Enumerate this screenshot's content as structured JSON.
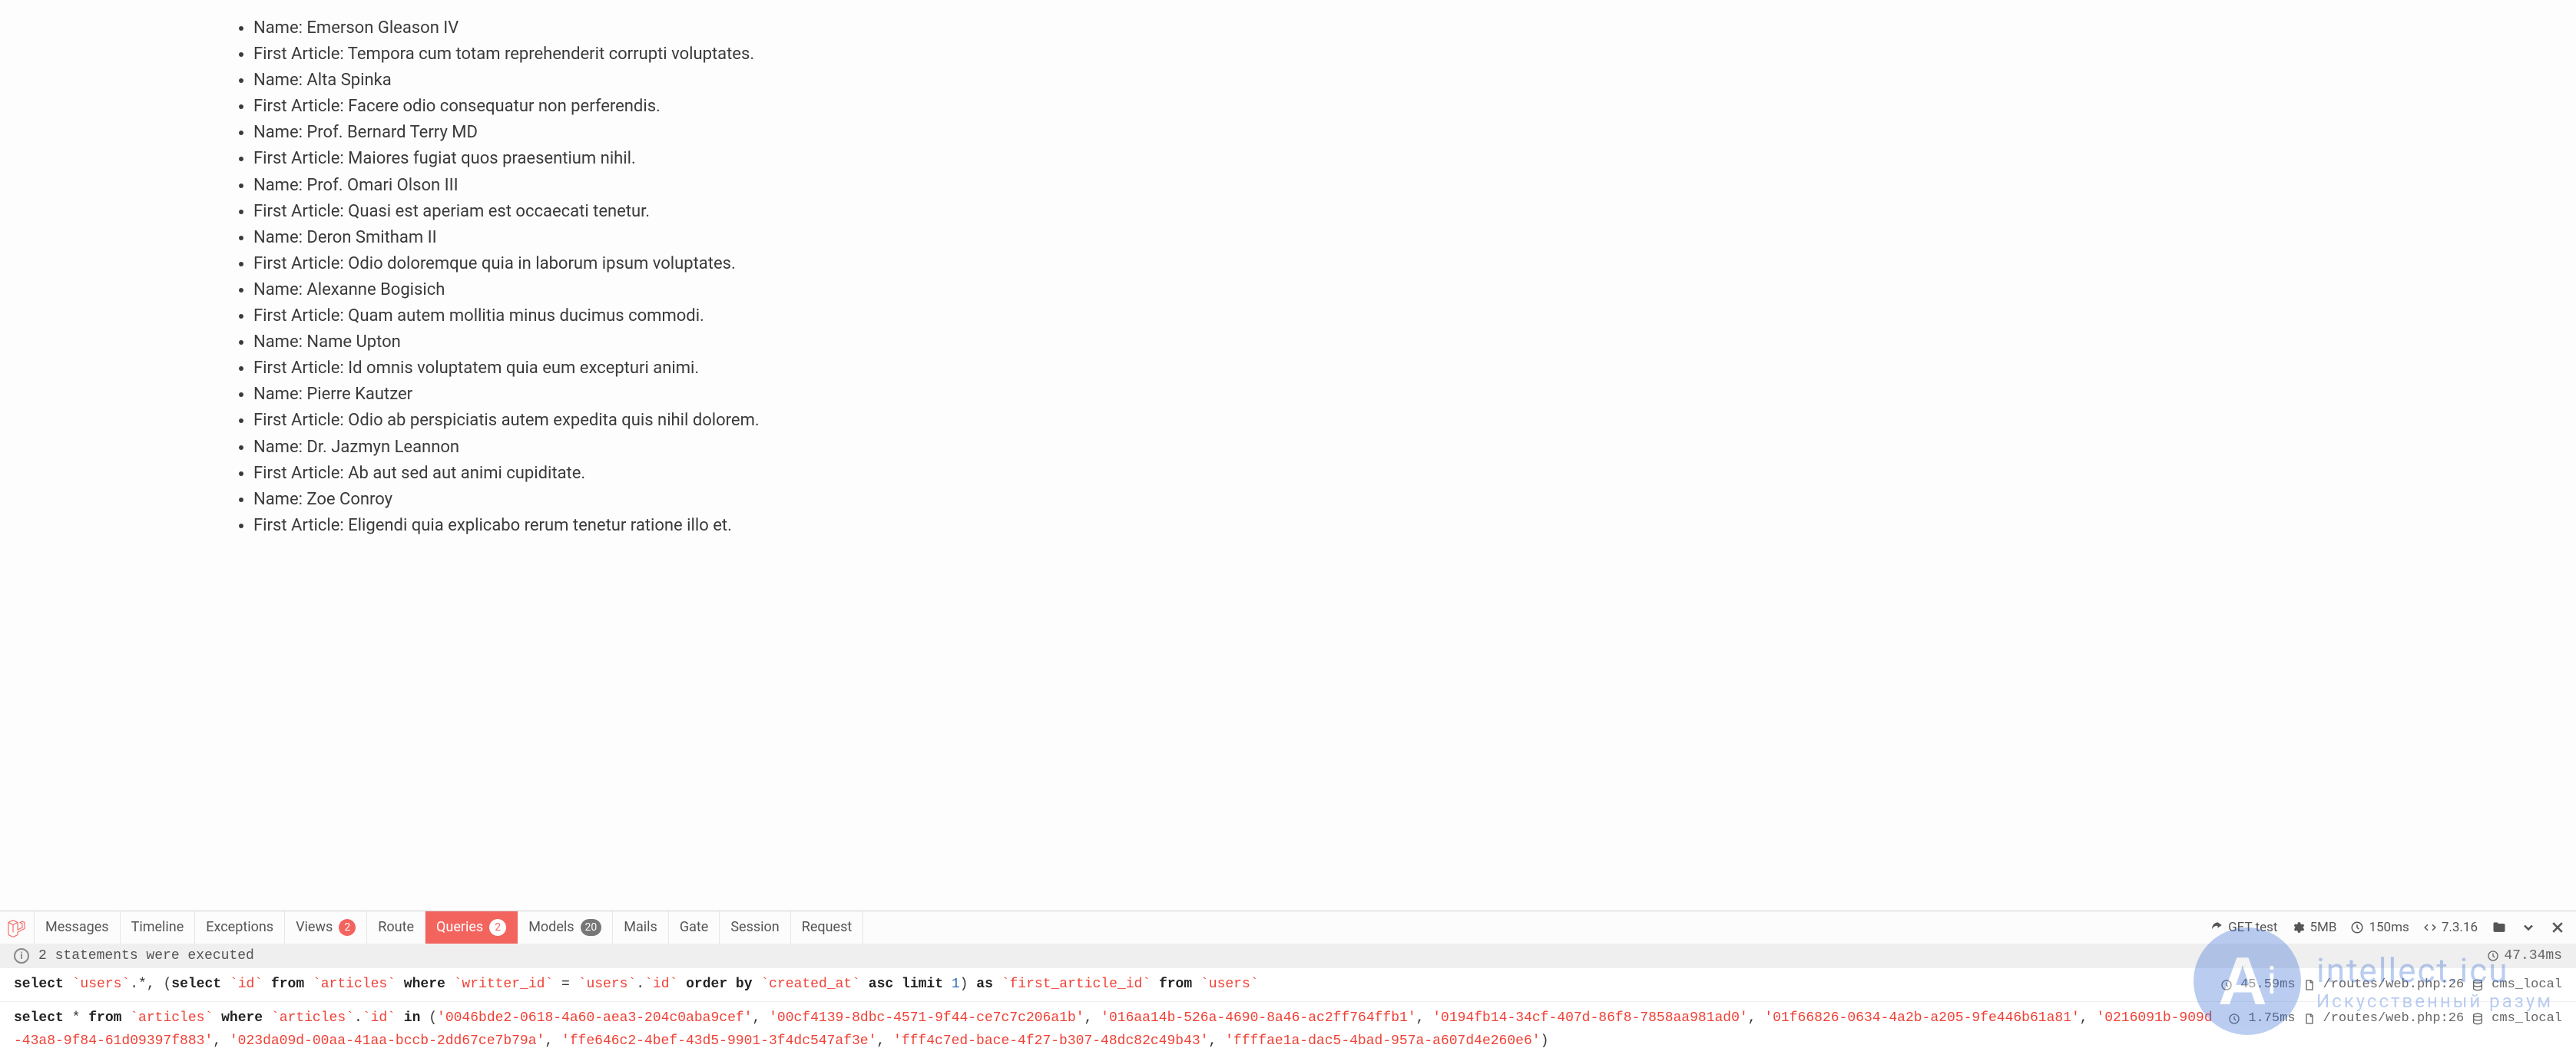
{
  "content": {
    "items": [
      {
        "name": "Emerson Gleason IV",
        "article": "Tempora cum totam reprehenderit corrupti voluptates."
      },
      {
        "name": "Alta Spinka",
        "article": "Facere odio consequatur non perferendis."
      },
      {
        "name": "Prof. Bernard Terry MD",
        "article": "Maiores fugiat quos praesentium nihil."
      },
      {
        "name": "Prof. Omari Olson III",
        "article": "Quasi est aperiam est occaecati tenetur."
      },
      {
        "name": "Deron Smitham II",
        "article": "Odio doloremque quia in laborum ipsum voluptates."
      },
      {
        "name": "Alexanne Bogisich",
        "article": "Quam autem mollitia minus ducimus commodi."
      },
      {
        "name": "Name Upton",
        "article": "Id omnis voluptatem quia eum excepturi animi."
      },
      {
        "name": "Pierre Kautzer",
        "article": "Odio ab perspiciatis autem expedita quis nihil dolorem."
      },
      {
        "name": "Dr. Jazmyn Leannon",
        "article": "Ab aut sed aut animi cupiditate."
      },
      {
        "name": "Zoe Conroy",
        "article": "Eligendi quia explicabo rerum tenetur ratione illo et."
      }
    ],
    "labels": {
      "name_prefix": "Name: ",
      "article_prefix": "First Article: "
    }
  },
  "debugbar": {
    "tabs": {
      "messages": "Messages",
      "timeline": "Timeline",
      "exceptions": "Exceptions",
      "views": "Views",
      "views_count": "2",
      "route": "Route",
      "queries": "Queries",
      "queries_count": "2",
      "models": "Models",
      "models_count": "20",
      "mails": "Mails",
      "gate": "Gate",
      "session": "Session",
      "request": "Request"
    },
    "right": {
      "method_url": "GET test",
      "memory": "5MB",
      "time": "150ms",
      "php": "7.3.16"
    },
    "status": {
      "text": "2 statements were executed",
      "total_time": "47.34ms"
    },
    "queries": [
      {
        "time": "45.59ms",
        "file": "/routes/web.php:26",
        "conn": "cms_local"
      },
      {
        "time": "1.75ms",
        "file": "/routes/web.php:26",
        "conn": "cms_local",
        "ids": [
          "0046bde2-0618-4a60-aea3-204c0aba9cef",
          "00cf4139-8dbc-4571-9f44-ce7c7c206a1b",
          "016aa14b-526a-4690-8a46-ac2ff764ffb1",
          "0194fb14-34cf-407d-86f8-7858aa981ad0",
          "01f66826-0634-4a2b-a205-9fe446b61a81",
          "0216091b-909d-43a8-9f84-61d09397f883",
          "023da09d-00aa-41aa-bccb-2dd67ce7b79a",
          "ffe646c2-4bef-43d5-9901-3f4dc547af3e",
          "fff4c7ed-bace-4f27-b307-48dc82c49b43",
          "ffffae1a-dac5-4bad-957a-a607d4e260e6"
        ]
      }
    ]
  },
  "watermark": {
    "line1": "intellect.icu",
    "line2": "Искусственный разум"
  }
}
